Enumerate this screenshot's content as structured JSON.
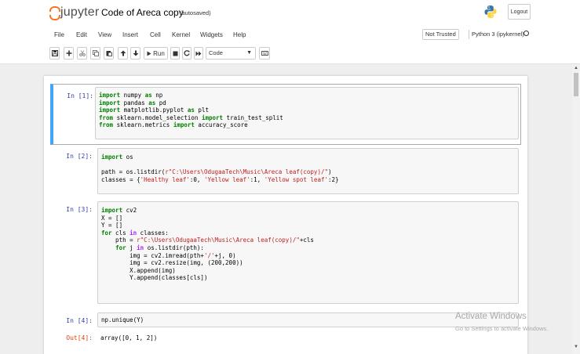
{
  "header": {
    "logo_text": "jupyter",
    "notebook_title": "Code of Areca copy",
    "save_status": "(autosaved)",
    "logout_label": "Logout",
    "python_logo": "python-logo-icon"
  },
  "menu": {
    "items": [
      "File",
      "Edit",
      "View",
      "Insert",
      "Cell",
      "Kernel",
      "Widgets",
      "Help"
    ],
    "not_trusted": "Not Trusted",
    "kernel_name": "Python 3 (ipykernel)",
    "kernel_status": "idle-circle-icon"
  },
  "toolbar": {
    "run_label": "Run",
    "cell_type": "Code",
    "icons": [
      "save-icon",
      "plus-icon",
      "cut-icon",
      "copy-icon",
      "paste-icon",
      "arrow-up-icon",
      "arrow-down-icon",
      "run-icon",
      "stop-icon",
      "restart-icon",
      "fast-forward-icon",
      "keyboard-icon"
    ]
  },
  "cells": [
    {
      "prompt": "In [1]:",
      "lines": [
        "import numpy as np",
        "import pandas as pd",
        "import matplotlib.pyplot as plt",
        "from sklearn.model_selection import train_test_split",
        "from sklearn.metrics import accuracy_score"
      ]
    },
    {
      "prompt": "In [2]:",
      "lines": [
        "import os",
        "",
        "path = os.listdir(r\"C:\\Users\\OdugaaTech\\Music\\Areca leaf(copy)/\")",
        "classes = {'Healthy leaf':0, 'Yellow leaf':1, 'Yellow spot leaf':2}"
      ]
    },
    {
      "prompt": "In [3]:",
      "lines": [
        "import cv2",
        "X = []",
        "Y = []",
        "for cls in classes:",
        "    pth = r\"C:\\Users\\OdugaaTech\\Music\\Areca leaf(copy)/\"+cls",
        "    for j in os.listdir(pth):",
        "        img = cv2.imread(pth+'/'+j, 0)",
        "        img = cv2.resize(img, (200,200))",
        "        X.append(img)",
        "        Y.append(classes[cls])"
      ]
    },
    {
      "prompt": "In [4]:",
      "lines": [
        "np.unique(Y)"
      ],
      "out_prompt": "Out[4]:",
      "output": "array([0, 1, 2])"
    }
  ],
  "watermark": {
    "title": "Activate Windows",
    "subtitle": "Go to Settings to activate Windows."
  },
  "colors": {
    "jupyter_orange": "#f37726",
    "prompt_in": "#303f9f",
    "prompt_out": "#d84315",
    "selected_cell": "#42a5f5",
    "keyword": "#008000",
    "string": "#ba2121"
  }
}
